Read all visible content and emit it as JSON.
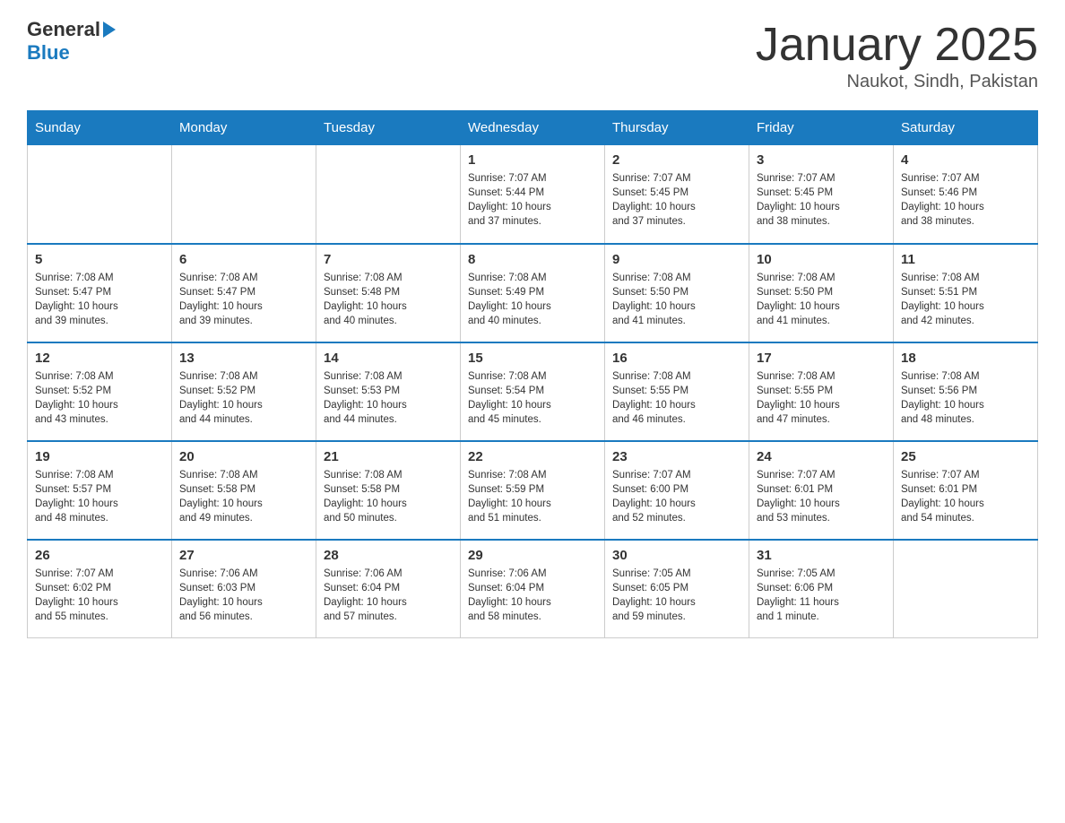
{
  "header": {
    "logo_general": "General",
    "logo_blue": "Blue",
    "title": "January 2025",
    "subtitle": "Naukot, Sindh, Pakistan"
  },
  "days_of_week": [
    "Sunday",
    "Monday",
    "Tuesday",
    "Wednesday",
    "Thursday",
    "Friday",
    "Saturday"
  ],
  "weeks": [
    [
      {
        "day": "",
        "info": ""
      },
      {
        "day": "",
        "info": ""
      },
      {
        "day": "",
        "info": ""
      },
      {
        "day": "1",
        "info": "Sunrise: 7:07 AM\nSunset: 5:44 PM\nDaylight: 10 hours\nand 37 minutes."
      },
      {
        "day": "2",
        "info": "Sunrise: 7:07 AM\nSunset: 5:45 PM\nDaylight: 10 hours\nand 37 minutes."
      },
      {
        "day": "3",
        "info": "Sunrise: 7:07 AM\nSunset: 5:45 PM\nDaylight: 10 hours\nand 38 minutes."
      },
      {
        "day": "4",
        "info": "Sunrise: 7:07 AM\nSunset: 5:46 PM\nDaylight: 10 hours\nand 38 minutes."
      }
    ],
    [
      {
        "day": "5",
        "info": "Sunrise: 7:08 AM\nSunset: 5:47 PM\nDaylight: 10 hours\nand 39 minutes."
      },
      {
        "day": "6",
        "info": "Sunrise: 7:08 AM\nSunset: 5:47 PM\nDaylight: 10 hours\nand 39 minutes."
      },
      {
        "day": "7",
        "info": "Sunrise: 7:08 AM\nSunset: 5:48 PM\nDaylight: 10 hours\nand 40 minutes."
      },
      {
        "day": "8",
        "info": "Sunrise: 7:08 AM\nSunset: 5:49 PM\nDaylight: 10 hours\nand 40 minutes."
      },
      {
        "day": "9",
        "info": "Sunrise: 7:08 AM\nSunset: 5:50 PM\nDaylight: 10 hours\nand 41 minutes."
      },
      {
        "day": "10",
        "info": "Sunrise: 7:08 AM\nSunset: 5:50 PM\nDaylight: 10 hours\nand 41 minutes."
      },
      {
        "day": "11",
        "info": "Sunrise: 7:08 AM\nSunset: 5:51 PM\nDaylight: 10 hours\nand 42 minutes."
      }
    ],
    [
      {
        "day": "12",
        "info": "Sunrise: 7:08 AM\nSunset: 5:52 PM\nDaylight: 10 hours\nand 43 minutes."
      },
      {
        "day": "13",
        "info": "Sunrise: 7:08 AM\nSunset: 5:52 PM\nDaylight: 10 hours\nand 44 minutes."
      },
      {
        "day": "14",
        "info": "Sunrise: 7:08 AM\nSunset: 5:53 PM\nDaylight: 10 hours\nand 44 minutes."
      },
      {
        "day": "15",
        "info": "Sunrise: 7:08 AM\nSunset: 5:54 PM\nDaylight: 10 hours\nand 45 minutes."
      },
      {
        "day": "16",
        "info": "Sunrise: 7:08 AM\nSunset: 5:55 PM\nDaylight: 10 hours\nand 46 minutes."
      },
      {
        "day": "17",
        "info": "Sunrise: 7:08 AM\nSunset: 5:55 PM\nDaylight: 10 hours\nand 47 minutes."
      },
      {
        "day": "18",
        "info": "Sunrise: 7:08 AM\nSunset: 5:56 PM\nDaylight: 10 hours\nand 48 minutes."
      }
    ],
    [
      {
        "day": "19",
        "info": "Sunrise: 7:08 AM\nSunset: 5:57 PM\nDaylight: 10 hours\nand 48 minutes."
      },
      {
        "day": "20",
        "info": "Sunrise: 7:08 AM\nSunset: 5:58 PM\nDaylight: 10 hours\nand 49 minutes."
      },
      {
        "day": "21",
        "info": "Sunrise: 7:08 AM\nSunset: 5:58 PM\nDaylight: 10 hours\nand 50 minutes."
      },
      {
        "day": "22",
        "info": "Sunrise: 7:08 AM\nSunset: 5:59 PM\nDaylight: 10 hours\nand 51 minutes."
      },
      {
        "day": "23",
        "info": "Sunrise: 7:07 AM\nSunset: 6:00 PM\nDaylight: 10 hours\nand 52 minutes."
      },
      {
        "day": "24",
        "info": "Sunrise: 7:07 AM\nSunset: 6:01 PM\nDaylight: 10 hours\nand 53 minutes."
      },
      {
        "day": "25",
        "info": "Sunrise: 7:07 AM\nSunset: 6:01 PM\nDaylight: 10 hours\nand 54 minutes."
      }
    ],
    [
      {
        "day": "26",
        "info": "Sunrise: 7:07 AM\nSunset: 6:02 PM\nDaylight: 10 hours\nand 55 minutes."
      },
      {
        "day": "27",
        "info": "Sunrise: 7:06 AM\nSunset: 6:03 PM\nDaylight: 10 hours\nand 56 minutes."
      },
      {
        "day": "28",
        "info": "Sunrise: 7:06 AM\nSunset: 6:04 PM\nDaylight: 10 hours\nand 57 minutes."
      },
      {
        "day": "29",
        "info": "Sunrise: 7:06 AM\nSunset: 6:04 PM\nDaylight: 10 hours\nand 58 minutes."
      },
      {
        "day": "30",
        "info": "Sunrise: 7:05 AM\nSunset: 6:05 PM\nDaylight: 10 hours\nand 59 minutes."
      },
      {
        "day": "31",
        "info": "Sunrise: 7:05 AM\nSunset: 6:06 PM\nDaylight: 11 hours\nand 1 minute."
      },
      {
        "day": "",
        "info": ""
      }
    ]
  ]
}
